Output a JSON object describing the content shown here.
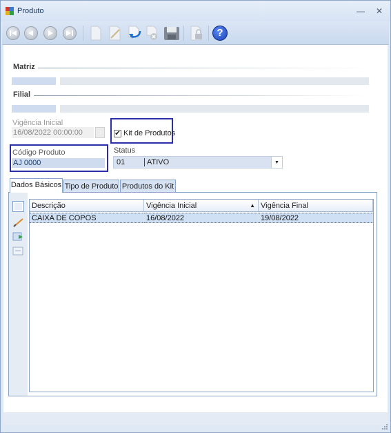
{
  "window": {
    "title": "Produto",
    "minimize": "—",
    "close": "✕"
  },
  "toolbar": {
    "buttons": [
      "first-record",
      "previous-record",
      "next-record",
      "last-record",
      "new-document",
      "edit-pencil",
      "undo",
      "cancel",
      "save-disk",
      "lock",
      "help"
    ],
    "help_glyph": "?"
  },
  "sections": {
    "matriz": "Matriz",
    "filial": "Filial"
  },
  "vigencia": {
    "label": "Vigência Inicial",
    "value": "16/08/2022 00:00:00"
  },
  "kit": {
    "label": "Kit de Produtos",
    "checked": "✔"
  },
  "codigo": {
    "label": "Código Produto",
    "value": "AJ 0000"
  },
  "status": {
    "label": "Status",
    "code": "01",
    "value": "ATIVO",
    "arrow": "▼"
  },
  "tabs": [
    {
      "label": "Dados Básicos",
      "active": true
    },
    {
      "label": "Tipo de Produto",
      "active": false
    },
    {
      "label": "Produtos do Kit",
      "active": false
    }
  ],
  "grid": {
    "columns": [
      "Descrição",
      "Vigência Inicial",
      "Vigência Final"
    ],
    "sort_indicator": "▲",
    "rows": [
      {
        "descricao": "CAIXA DE COPOS",
        "vig_inicial": "16/08/2022",
        "vig_final": "19/08/2022"
      }
    ]
  },
  "colors": {
    "highlight": "#2b2ea8",
    "help_blue": "#1b3fb8",
    "accent": "#cfdcef"
  }
}
